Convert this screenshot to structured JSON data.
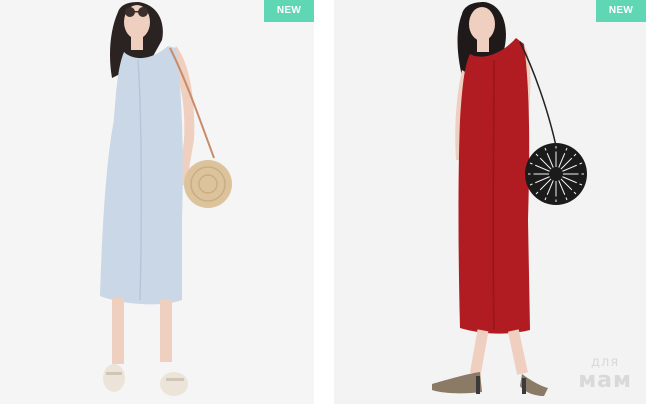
{
  "products": [
    {
      "badge": "NEW",
      "dress_color": "#c9d7e6",
      "bag": "round-straw-bag"
    },
    {
      "badge": "NEW",
      "dress_color": "#b01c22",
      "bag": "round-black-fan-bag"
    }
  ],
  "colors": {
    "badge_bg": "#5fd7b5",
    "badge_text": "#ffffff"
  },
  "watermark": {
    "top": "для",
    "bottom": "мам"
  }
}
